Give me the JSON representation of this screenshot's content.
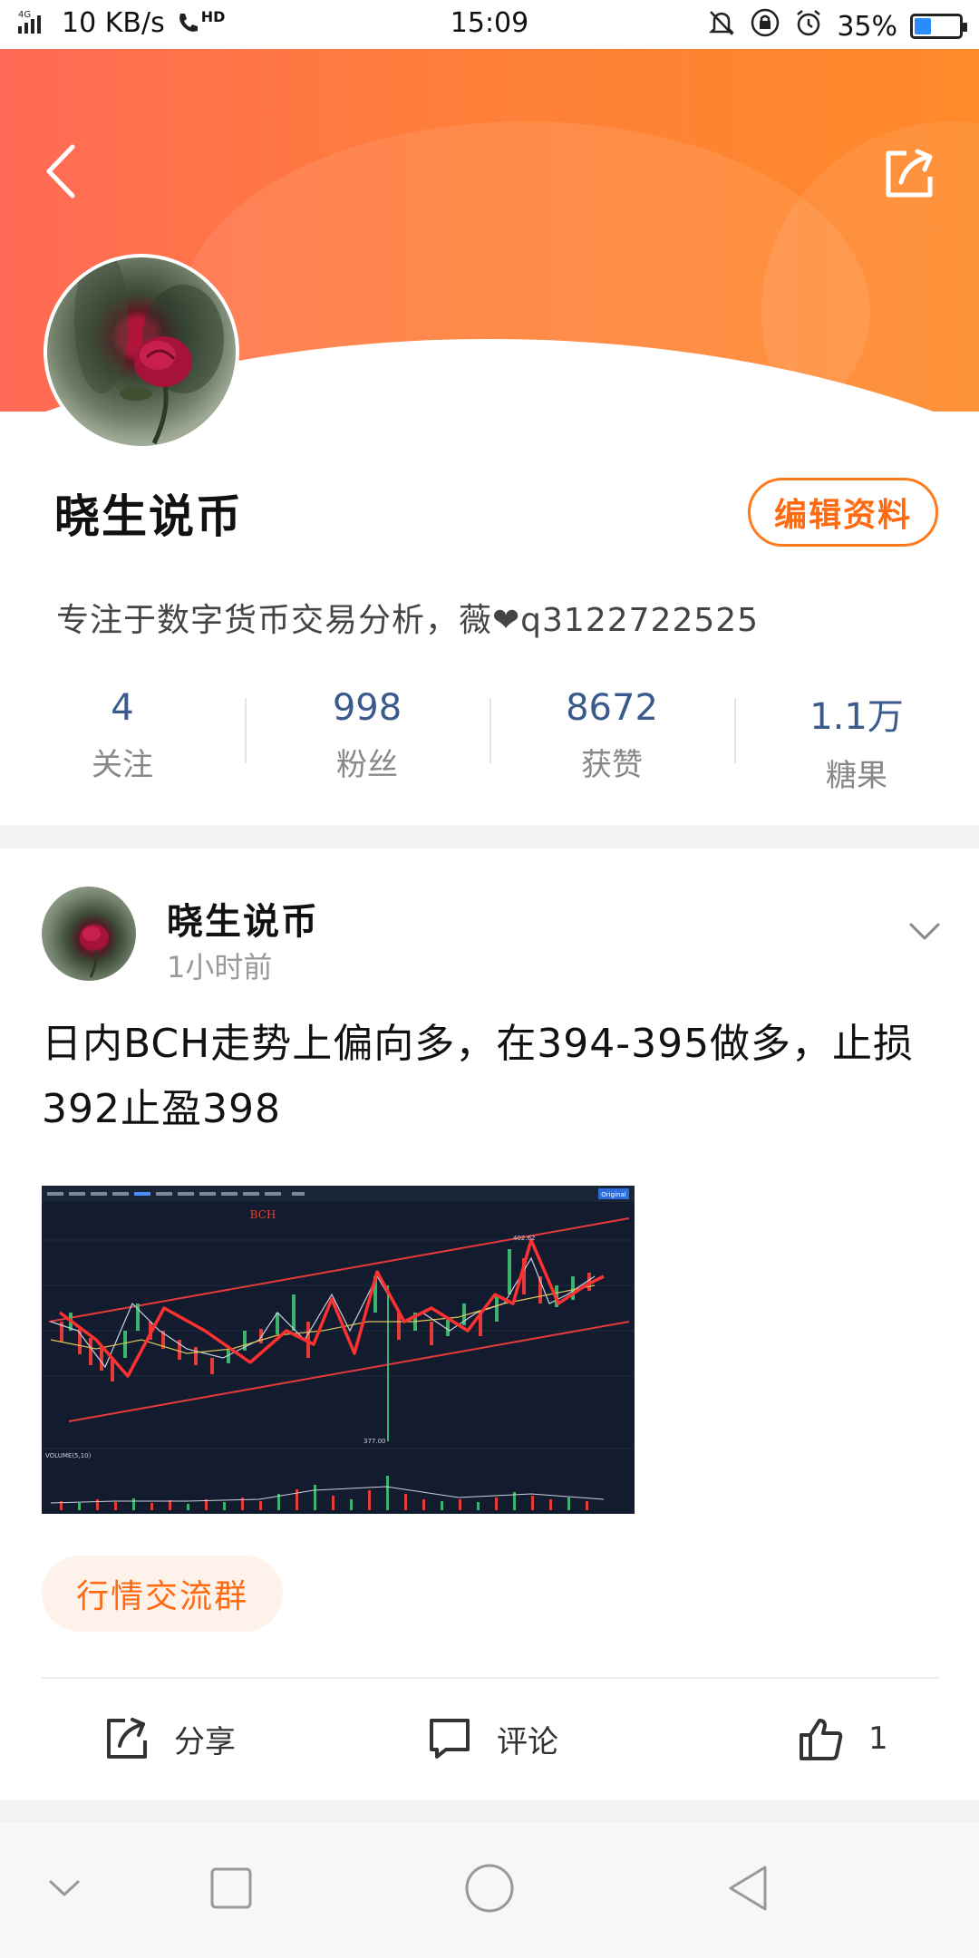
{
  "status_bar": {
    "network": "4G",
    "speed": "10 KB/s",
    "hd": "HD",
    "time": "15:09",
    "battery_text": "35%",
    "battery_level": 0.35
  },
  "profile": {
    "name": "晓生说币",
    "edit_label": "编辑资料",
    "bio": "专注于数字货币交易分析，薇❤q3122722525",
    "stats": [
      {
        "value": "4",
        "label": "关注"
      },
      {
        "value": "998",
        "label": "粉丝"
      },
      {
        "value": "8672",
        "label": "获赞"
      },
      {
        "value": "1.1万",
        "label": "糖果"
      }
    ]
  },
  "post": {
    "author": "晓生说币",
    "time": "1小时前",
    "text": "日内BCH走势上偏向多，在394-395做多，止损392止盈398",
    "chart_image": {
      "symbol": "BCH",
      "high_label": "402.62",
      "low_label": "377.00",
      "volume_label": "VOLUME(5,10)",
      "badge": "Original"
    },
    "tag": "行情交流群",
    "actions": {
      "share": "分享",
      "comment": "评论",
      "like_count": "1"
    }
  },
  "colors": {
    "accent": "#ff6a10",
    "stat_number": "#3a5a8c"
  }
}
